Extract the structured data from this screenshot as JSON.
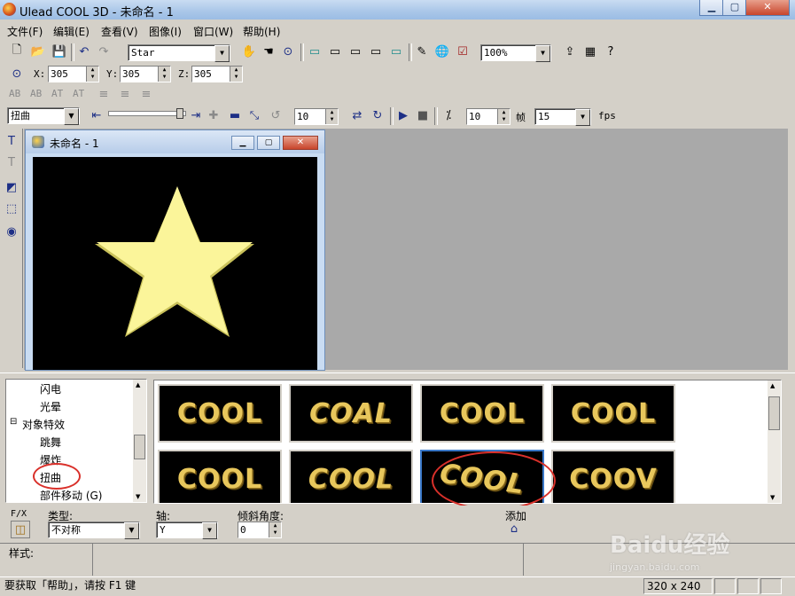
{
  "window": {
    "title": "Ulead COOL 3D - 未命名 - 1"
  },
  "menu": [
    "文件(F)",
    "编辑(E)",
    "查看(V)",
    "图像(I)",
    "窗口(W)",
    "帮助(H)"
  ],
  "toolbar": {
    "object_select": "Star",
    "zoom": "100%"
  },
  "position": {
    "x_label": "X:",
    "x": "305",
    "y_label": "Y:",
    "y": "305",
    "z_label": "Z:",
    "z": "305"
  },
  "text_tools": [
    "AB",
    "AB",
    "AT",
    "AT"
  ],
  "animation": {
    "effect_select": "扭曲",
    "frame": "10",
    "frame_count": "10",
    "frame_label": "帧",
    "fps": "15",
    "fps_label": "fps"
  },
  "document": {
    "title": "未命名 - 1"
  },
  "tree": {
    "items": [
      {
        "label": "闪电",
        "indent": 2
      },
      {
        "label": "光晕",
        "indent": 2
      },
      {
        "label": "对象特效",
        "indent": 0,
        "toggle": "⊟"
      },
      {
        "label": "跳舞",
        "indent": 2
      },
      {
        "label": "爆炸",
        "indent": 2
      },
      {
        "label": "扭曲",
        "indent": 2
      },
      {
        "label": "部件移动 (G)",
        "indent": 2
      }
    ]
  },
  "gallery": {
    "thumb_text": "COOL",
    "thumbs": [
      "COOL",
      "COAL",
      "COOL",
      "COOL",
      "COOL",
      "COOL",
      "COOL",
      "COOV"
    ]
  },
  "properties": {
    "fx_label": "F/X",
    "type_label": "类型:",
    "type_value": "不对称",
    "axis_label": "轴:",
    "axis_value": "Y",
    "tilt_label": "倾斜角度:",
    "tilt_value": "0",
    "add_label": "添加"
  },
  "style": {
    "label": "样式:"
  },
  "status": {
    "help": "要获取「帮助」，请按 F1 键",
    "size": "320 x 240"
  },
  "watermark": {
    "brand": "Baidu经验",
    "url": "jingyan.baidu.com"
  },
  "colors": {
    "star": "#fbf59a",
    "canvas": "#000000",
    "cool_gold": "#e8c75c",
    "highlight": "#d9302a"
  }
}
